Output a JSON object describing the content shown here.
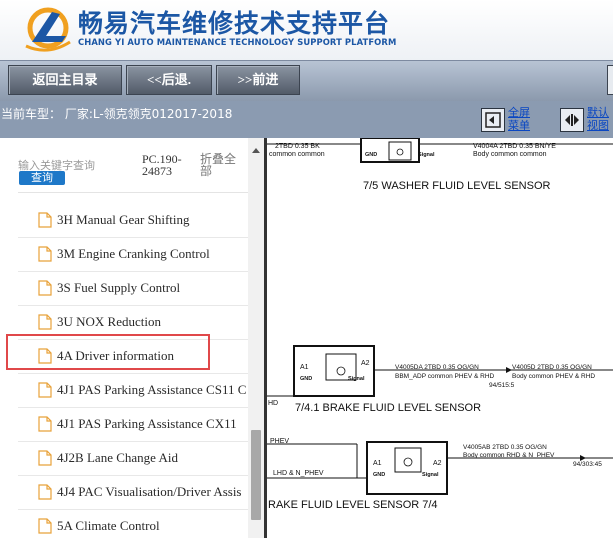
{
  "header": {
    "title": "畅易汽车维修技术支持平台",
    "subtitle": "CHANG YI AUTO MAINTENANCE TECHNOLOGY SUPPORT PLATFORM",
    "logo_icon": "chang-yi-logo-icon"
  },
  "toolbar": {
    "home_label": "返回主目录",
    "back_label": "<<后退.",
    "forward_label": ">>前进"
  },
  "infobar": {
    "model_text": "当前车型： 厂家:L-领克领克012017-2018",
    "fullscreen_label": "全屏\n菜单",
    "default_view_label": "默认\n视图"
  },
  "sidebar": {
    "search_placeholder": "输入关键字查询",
    "search_button": "查询",
    "pc_code": "PC.190-\n24873",
    "collapse_all": "折叠全\n部",
    "items": [
      {
        "label": "3H Manual Gear Shifting"
      },
      {
        "label": "3M Engine Cranking Control"
      },
      {
        "label": "3S Fuel Supply Control"
      },
      {
        "label": "3U NOX Reduction"
      },
      {
        "label": "4A Driver information"
      },
      {
        "label": "4J1 PAS Parking Assistance CS11 C"
      },
      {
        "label": "4J1 PAS Parking Assistance CX11"
      },
      {
        "label": "4J2B Lane Change Aid"
      },
      {
        "label": "4J4 PAC Visualisation/Driver Assis"
      },
      {
        "label": "5A Climate Control"
      }
    ],
    "selected_item": "4A Driver information"
  },
  "diagram": {
    "top_wire_left": "2TBD 0.35 BK",
    "top_wire_left_sub": "common  common",
    "top_wire_right": "V4004A  2TBD 0.35 BN/YE",
    "top_wire_right_sub": "Body common   common",
    "gnd1": "GND",
    "signal1": "Signal",
    "washer_label": "7/5   WASHER FLUID LEVEL SENSOR",
    "a1": "A1",
    "a2": "A2",
    "gnd": "GND",
    "signal": "Signal",
    "wire2_code": "V4005DA  2TBD 0.35 OG/GN",
    "wire2_sub": "BBM_ADP   common   PHEV & RHD",
    "wire2_code_r": "V4005D  2TBD 0.35 OG/GN",
    "wire2_sub_r": "Body common   PHEV & RHD",
    "wire2_ref": "94/515:5",
    "hd_label": "HD",
    "brake_label_1": "7/4.1     BRAKE FLUID LEVEL SENSOR",
    "phev": "PHEV",
    "lhd_nphev": "LHD & N_PHEV",
    "wire3_code": "V4005AB  2TBD 0.35 OG/GN",
    "wire3_sub": "Body common   RHD & N_PHEV",
    "wire3_ref": "94/303:45",
    "brake_label_2": "RAKE FLUID LEVEL SENSOR      7/4"
  },
  "colors": {
    "brand_blue": "#1c57a5",
    "toolbar_button": "#5e6774",
    "infobar_bg": "#8b9bb1",
    "highlight_red": "#e0484a",
    "search_button": "#1e78c8"
  }
}
